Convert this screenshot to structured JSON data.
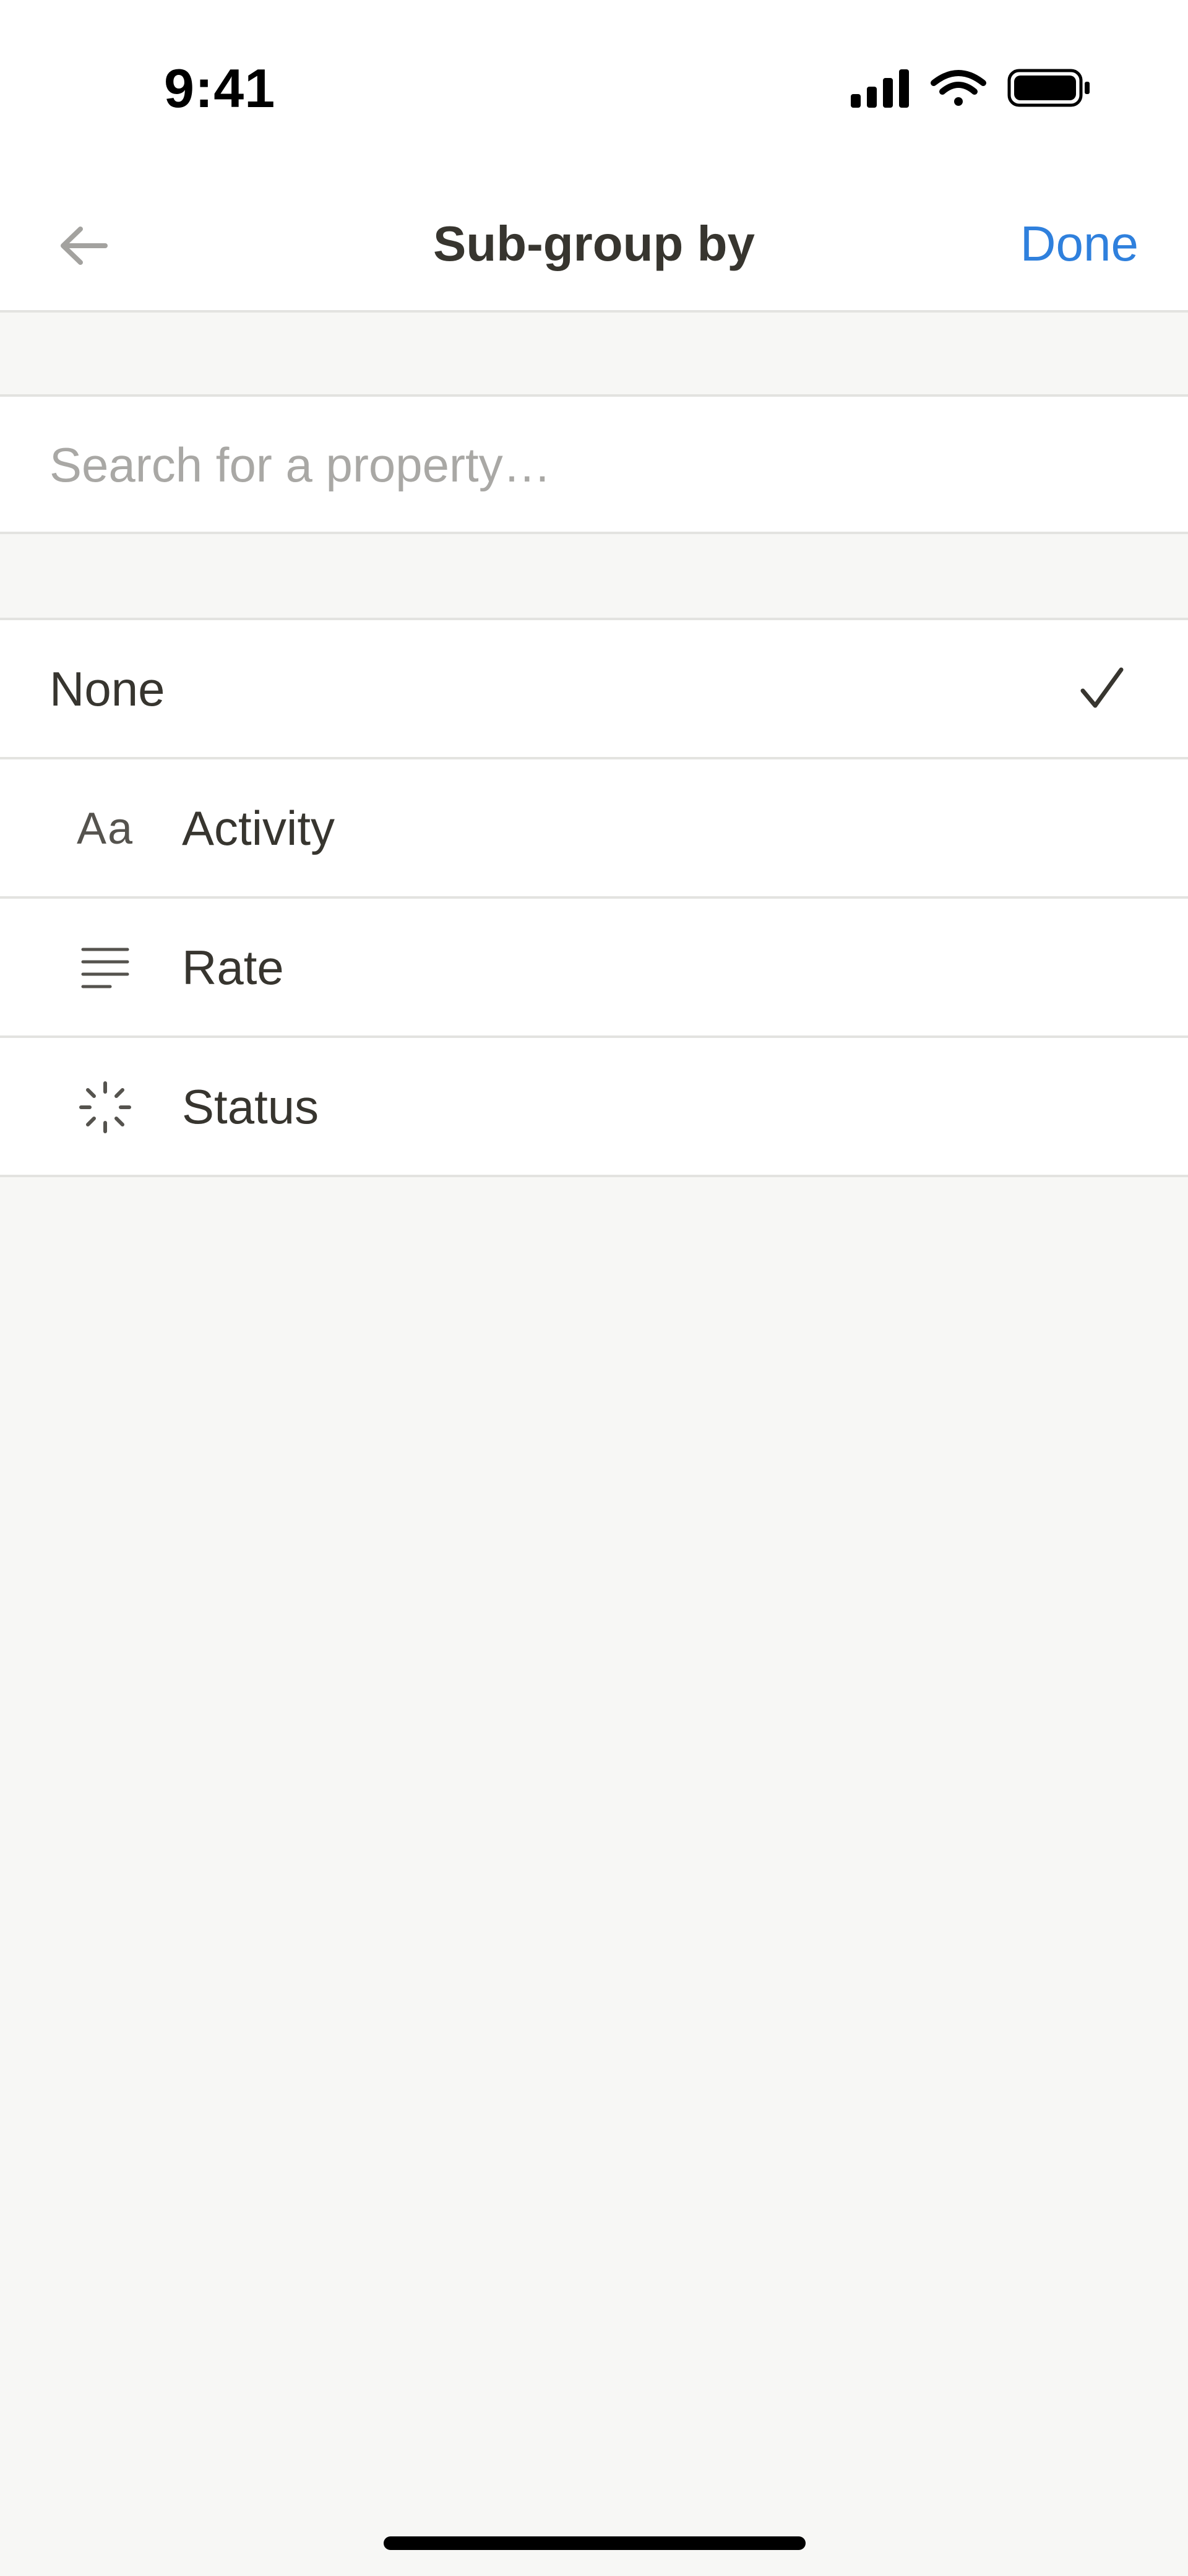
{
  "status_bar": {
    "time": "9:41"
  },
  "nav": {
    "title": "Sub-group by",
    "done_label": "Done"
  },
  "search": {
    "placeholder": "Search for a property…",
    "value": ""
  },
  "options": [
    {
      "label": "None",
      "icon": "none",
      "selected": true
    },
    {
      "label": "Activity",
      "icon": "text-aa-icon",
      "selected": false
    },
    {
      "label": "Rate",
      "icon": "lines-icon",
      "selected": false
    },
    {
      "label": "Status",
      "icon": "status-spinner-icon",
      "selected": false
    }
  ],
  "colors": {
    "accent": "#2F80DD",
    "text": "#37352F",
    "placeholder": "#A9A8A5",
    "background": "#F7F7F5",
    "divider": "#E3E3E0"
  }
}
